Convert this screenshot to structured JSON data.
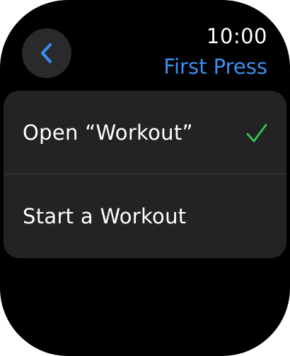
{
  "header": {
    "time": "10:00",
    "title": "First Press",
    "back_icon": "chevron-left-icon"
  },
  "options": [
    {
      "label": "Open “Workout”",
      "selected": true
    },
    {
      "label": "Start a Workout",
      "selected": false
    }
  ],
  "colors": {
    "accent": "#3b8ff0",
    "check": "#30d158",
    "background": "#000000",
    "list_background": "#232325",
    "back_button_background": "#2a2a2c"
  }
}
